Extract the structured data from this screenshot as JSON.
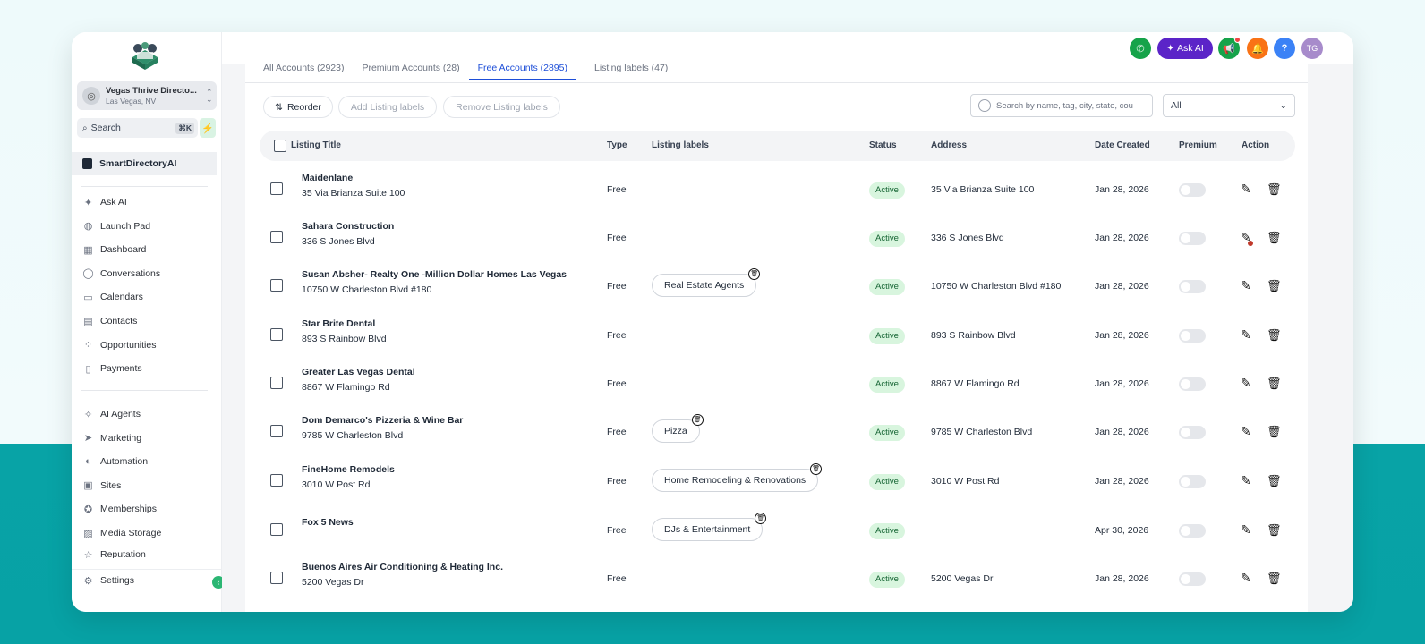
{
  "sidebar": {
    "location_name": "Vegas Thrive Directo...",
    "location_city": "Las Vegas, NV",
    "search_label": "Search",
    "search_shortcut": "⌘K",
    "brand": "SmartDirectoryAI",
    "items_group1": [
      {
        "label": "Ask AI",
        "icon": "sparkle-icon"
      },
      {
        "label": "Launch Pad",
        "icon": "rocket-icon"
      },
      {
        "label": "Dashboard",
        "icon": "grid-icon"
      },
      {
        "label": "Conversations",
        "icon": "chat-icon"
      },
      {
        "label": "Calendars",
        "icon": "calendar-icon"
      },
      {
        "label": "Contacts",
        "icon": "contacts-icon"
      },
      {
        "label": "Opportunities",
        "icon": "opportunities-icon"
      },
      {
        "label": "Payments",
        "icon": "payments-icon"
      }
    ],
    "items_group2": [
      {
        "label": "AI Agents",
        "icon": "ai-agents-icon"
      },
      {
        "label": "Marketing",
        "icon": "send-icon"
      },
      {
        "label": "Automation",
        "icon": "automation-icon"
      },
      {
        "label": "Sites",
        "icon": "sites-icon"
      },
      {
        "label": "Memberships",
        "icon": "membership-icon"
      },
      {
        "label": "Media Storage",
        "icon": "image-icon"
      },
      {
        "label": "Reputation",
        "icon": "star-icon"
      }
    ],
    "settings_label": "Settings"
  },
  "topbar": {
    "ask_ai_label": "Ask AI",
    "avatar_initials": "TG",
    "help_label": "?"
  },
  "tabs": [
    {
      "label": "All Accounts (2923)",
      "active": false
    },
    {
      "label": "Premium Accounts (28)",
      "active": false
    },
    {
      "label": "Free Accounts (2895)",
      "active": true
    },
    {
      "label": "Listing labels (47)",
      "active": false
    }
  ],
  "toolbar": {
    "reorder_label": "Reorder",
    "add_labels_label": "Add Listing labels",
    "remove_labels_label": "Remove Listing labels",
    "search_placeholder": "Search by name, tag, city, state, cou",
    "filter_value": "All"
  },
  "table": {
    "headers": {
      "title": "Listing Title",
      "type": "Type",
      "labels": "Listing labels",
      "status": "Status",
      "address": "Address",
      "date": "Date Created",
      "premium": "Premium",
      "action": "Action"
    },
    "rows": [
      {
        "title": "Maidenlane",
        "subtitle": "35 Via Brianza Suite 100",
        "type": "Free",
        "label": "",
        "status": "Active",
        "address": "35 Via Brianza Suite 100",
        "date": "Jan 28, 2026"
      },
      {
        "title": "Sahara Construction",
        "subtitle": "336 S Jones Blvd",
        "type": "Free",
        "label": "",
        "status": "Active",
        "address": "336 S Jones Blvd",
        "date": "Jan 28, 2026"
      },
      {
        "title": "Susan Absher- Realty One -Million Dollar Homes Las Vegas",
        "subtitle": "10750 W Charleston Blvd #180",
        "type": "Free",
        "label": "Real Estate Agents",
        "status": "Active",
        "address": "10750 W Charleston Blvd #180",
        "date": "Jan 28, 2026"
      },
      {
        "title": "Star Brite Dental",
        "subtitle": "893 S Rainbow Blvd",
        "type": "Free",
        "label": "",
        "status": "Active",
        "address": "893 S Rainbow Blvd",
        "date": "Jan 28, 2026"
      },
      {
        "title": "Greater Las Vegas Dental",
        "subtitle": "8867 W Flamingo Rd",
        "type": "Free",
        "label": "",
        "status": "Active",
        "address": "8867 W Flamingo Rd",
        "date": "Jan 28, 2026"
      },
      {
        "title": "Dom Demarco's Pizzeria & Wine Bar",
        "subtitle": "9785 W Charleston Blvd",
        "type": "Free",
        "label": "Pizza",
        "status": "Active",
        "address": "9785 W Charleston Blvd",
        "date": "Jan 28, 2026"
      },
      {
        "title": "FineHome Remodels",
        "subtitle": "3010 W Post Rd",
        "type": "Free",
        "label": "Home Remodeling & Renovations",
        "status": "Active",
        "address": "3010 W Post Rd",
        "date": "Jan 28, 2026"
      },
      {
        "title": "Fox 5 News",
        "subtitle": "",
        "type": "Free",
        "label": "DJs & Entertainment",
        "status": "Active",
        "address": "",
        "date": "Apr 30, 2026"
      },
      {
        "title": "Buenos Aires Air Conditioning & Heating Inc.",
        "subtitle": "5200 Vegas Dr",
        "type": "Free",
        "label": "",
        "status": "Active",
        "address": "5200 Vegas Dr",
        "date": "Jan 28, 2026"
      }
    ]
  },
  "colors": {
    "accent": "#1d4ed8",
    "status_bg": "#d8f5de",
    "ask_ai_bg": "#5b24c8",
    "phone_bg": "#16a34a",
    "bell_bg": "#f97316",
    "help_bg": "#3b82f6",
    "avatar_bg": "#a78bcb",
    "backdrop_teal": "#08a3a6"
  }
}
